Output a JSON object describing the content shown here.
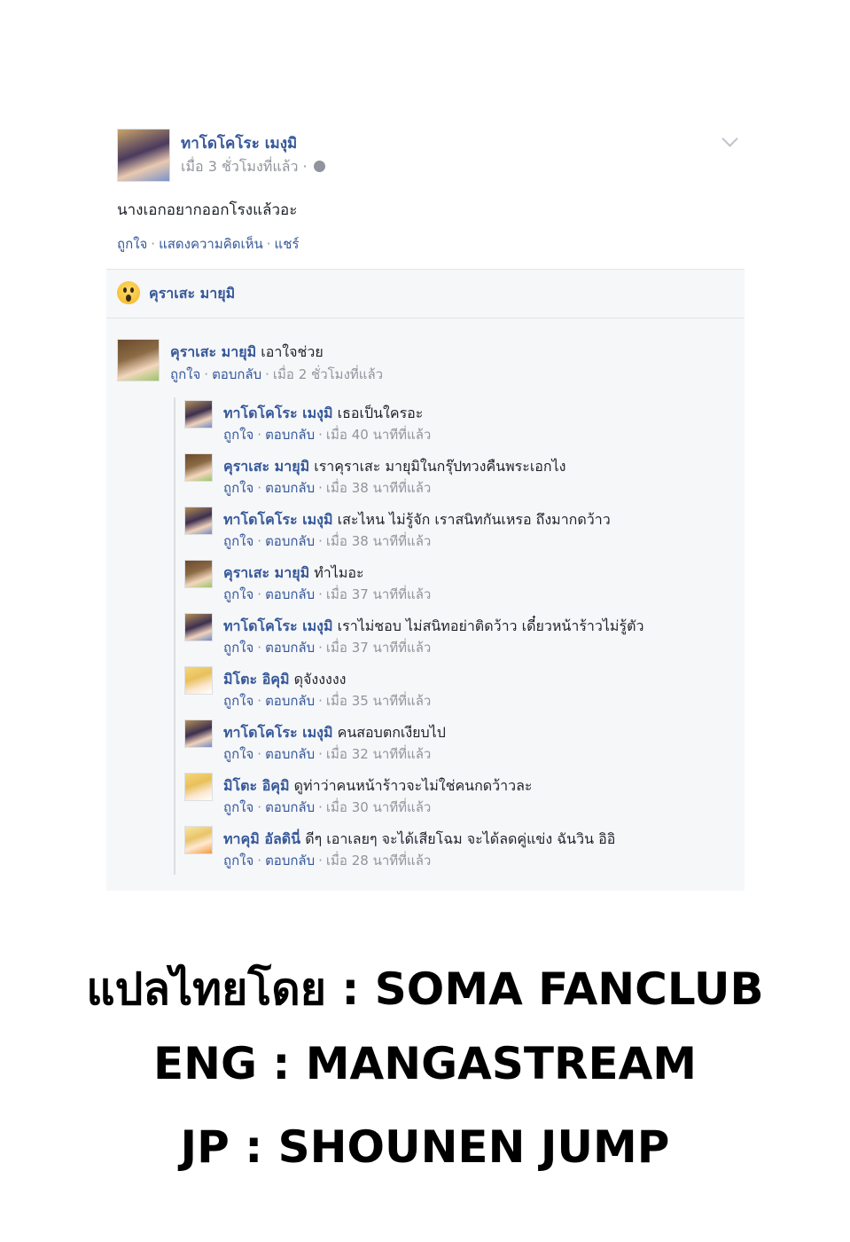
{
  "post": {
    "author": "ทาโดโคโระ เมงุมิ",
    "meta": "เมื่อ 3 ชั่วโมงที่แล้ว ·",
    "text": "นางเอกอยากออกโรงแล้วอะ",
    "actions": {
      "like": "ถูกใจ",
      "comment": "แสดงความคิดเห็น",
      "share": "แชร์"
    }
  },
  "reactions": {
    "reactor": "คุราเสะ มายุมิ"
  },
  "comments": [
    {
      "name": "คุราเสะ มายุมิ",
      "text": "เอาใจช่วย",
      "like": "ถูกใจ",
      "reply": "ตอบกลับ",
      "time": "เมื่อ 2 ชั่วโมงที่แล้ว"
    }
  ],
  "replies": [
    {
      "name": "ทาโดโคโระ เมงุมิ",
      "text": "เธอเป็นใครอะ",
      "like": "ถูกใจ",
      "reply": "ตอบกลับ",
      "time": "เมื่อ 40 นาทีที่แล้ว"
    },
    {
      "name": "คุราเสะ มายุมิ",
      "text": "เราคุราเสะ มายุมิในกรุ๊ปทวงคืนพระเอกไง",
      "like": "ถูกใจ",
      "reply": "ตอบกลับ",
      "time": "เมื่อ 38 นาทีที่แล้ว"
    },
    {
      "name": "ทาโดโคโระ เมงุมิ",
      "text": "เสะไหน ไม่รู้จัก เราสนิทกันเหรอ ถึงมากดว้าว",
      "like": "ถูกใจ",
      "reply": "ตอบกลับ",
      "time": "เมื่อ 38 นาทีที่แล้ว"
    },
    {
      "name": "คุราเสะ มายุมิ",
      "text": "ทำไมอะ",
      "like": "ถูกใจ",
      "reply": "ตอบกลับ",
      "time": "เมื่อ 37 นาทีที่แล้ว"
    },
    {
      "name": "ทาโดโคโระ เมงุมิ",
      "text": "เราไม่ชอบ ไม่สนิทอย่าติดว้าว เดี๋ยวหน้าร้าวไม่รู้ตัว",
      "like": "ถูกใจ",
      "reply": "ตอบกลับ",
      "time": "เมื่อ 37 นาทีที่แล้ว"
    },
    {
      "name": "มิโตะ อิคุมิ",
      "text": "ดุจังงงงง",
      "like": "ถูกใจ",
      "reply": "ตอบกลับ",
      "time": "เมื่อ 35 นาทีที่แล้ว"
    },
    {
      "name": "ทาโดโคโระ เมงุมิ",
      "text": "คนสอบตกเงียบไป",
      "like": "ถูกใจ",
      "reply": "ตอบกลับ",
      "time": "เมื่อ 32 นาทีที่แล้ว"
    },
    {
      "name": "มิโตะ อิคุมิ",
      "text": "ดูท่าว่าคนหน้าร้าวจะไม่ใช่คนกดว้าวละ",
      "like": "ถูกใจ",
      "reply": "ตอบกลับ",
      "time": "เมื่อ 30 นาทีที่แล้ว"
    },
    {
      "name": "ทาคุมิ อัลดินี่",
      "text": "ดีๆ เอาเลยๆ จะได้เสียโฉม จะได้ลดคู่แข่ง ฉันวิน อิอิ",
      "like": "ถูกใจ",
      "reply": "ตอบกลับ",
      "time": "เมื่อ 28 นาทีที่แล้ว"
    }
  ],
  "credits": {
    "line1": "แปลไทยโดย : SOMA FANCLUB",
    "line2": "ENG : MANGASTREAM",
    "line3": "JP : SHOUNEN JUMP"
  }
}
